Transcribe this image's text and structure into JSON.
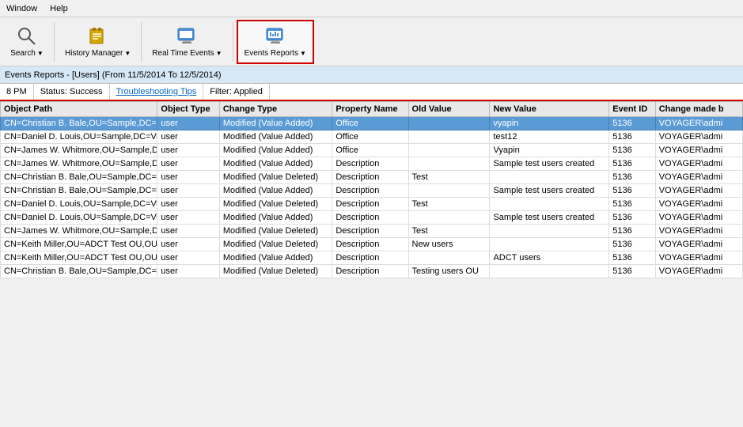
{
  "menu": {
    "items": [
      "Window",
      "Help"
    ]
  },
  "toolbar": {
    "buttons": [
      {
        "id": "search",
        "label": "Search",
        "icon": "🔍",
        "hasDropdown": true,
        "active": false
      },
      {
        "id": "history-manager",
        "label": "History Manager",
        "icon": "📁",
        "hasDropdown": true,
        "active": false
      },
      {
        "id": "real-time-events",
        "label": "Real Time Events",
        "icon": "🖥",
        "hasDropdown": true,
        "active": false
      },
      {
        "id": "events-reports",
        "label": "Events Reports",
        "icon": "📊",
        "hasDropdown": true,
        "active": true
      }
    ]
  },
  "breadcrumb": {
    "text": "Events Reports - [Users] (From 11/5/2014 To 12/5/2014)"
  },
  "status_bar": {
    "time": "8 PM",
    "status": "Status: Success",
    "tips": "Troubleshooting Tips",
    "filter": "Filter: Applied"
  },
  "table": {
    "columns": [
      "Object Path",
      "Object Type",
      "Change Type",
      "Property Name",
      "Old Value",
      "New Value",
      "Event ID",
      "Change made b"
    ],
    "rows": [
      {
        "selected": true,
        "object_path": "CN=Christian B. Bale,OU=Sample,DC=Voyager,DC=local",
        "object_type": "user",
        "change_type": "Modified (Value Added)",
        "property_name": "Office",
        "old_value": "",
        "new_value": "vyapin",
        "event_id": "5136",
        "change_by": "VOYAGER\\admi"
      },
      {
        "selected": false,
        "object_path": "CN=Daniel D. Louis,OU=Sample,DC=Voyager,DC=local",
        "object_type": "user",
        "change_type": "Modified (Value Added)",
        "property_name": "Office",
        "old_value": "",
        "new_value": "test12",
        "event_id": "5136",
        "change_by": "VOYAGER\\admi"
      },
      {
        "selected": false,
        "object_path": "CN=James W. Whitmore,OU=Sample,DC=Voyager,DC=local",
        "object_type": "user",
        "change_type": "Modified (Value Added)",
        "property_name": "Office",
        "old_value": "",
        "new_value": "Vyapin",
        "event_id": "5136",
        "change_by": "VOYAGER\\admi"
      },
      {
        "selected": false,
        "object_path": "CN=James W. Whitmore,OU=Sample,DC=Voyager,DC=local",
        "object_type": "user",
        "change_type": "Modified (Value Added)",
        "property_name": "Description",
        "old_value": "",
        "new_value": "Sample test users created",
        "event_id": "5136",
        "change_by": "VOYAGER\\admi"
      },
      {
        "selected": false,
        "object_path": "CN=Christian B. Bale,OU=Sample,DC=Voyager,DC=local",
        "object_type": "user",
        "change_type": "Modified (Value Deleted)",
        "property_name": "Description",
        "old_value": "Test",
        "new_value": "",
        "event_id": "5136",
        "change_by": "VOYAGER\\admi"
      },
      {
        "selected": false,
        "object_path": "CN=Christian B. Bale,OU=Sample,DC=Voyager,DC=local",
        "object_type": "user",
        "change_type": "Modified (Value Added)",
        "property_name": "Description",
        "old_value": "",
        "new_value": "Sample test users created",
        "event_id": "5136",
        "change_by": "VOYAGER\\admi"
      },
      {
        "selected": false,
        "object_path": "CN=Daniel D. Louis,OU=Sample,DC=Voyager,DC=local",
        "object_type": "user",
        "change_type": "Modified (Value Deleted)",
        "property_name": "Description",
        "old_value": "Test",
        "new_value": "",
        "event_id": "5136",
        "change_by": "VOYAGER\\admi"
      },
      {
        "selected": false,
        "object_path": "CN=Daniel D. Louis,OU=Sample,DC=Voyager,DC=local",
        "object_type": "user",
        "change_type": "Modified (Value Added)",
        "property_name": "Description",
        "old_value": "",
        "new_value": "Sample test users created",
        "event_id": "5136",
        "change_by": "VOYAGER\\admi"
      },
      {
        "selected": false,
        "object_path": "CN=James W. Whitmore,OU=Sample,DC=Voyager,DC=local",
        "object_type": "user",
        "change_type": "Modified (Value Deleted)",
        "property_name": "Description",
        "old_value": "Test",
        "new_value": "",
        "event_id": "5136",
        "change_by": "VOYAGER\\admi"
      },
      {
        "selected": false,
        "object_path": "CN=Keith Miller,OU=ADCT Test OU,OU=ARKAD_Workshop,DC=Voyager,DC=local",
        "object_type": "user",
        "change_type": "Modified (Value Deleted)",
        "property_name": "Description",
        "old_value": "New users",
        "new_value": "",
        "event_id": "5136",
        "change_by": "VOYAGER\\admi"
      },
      {
        "selected": false,
        "object_path": "CN=Keith Miller,OU=ADCT Test OU,OU=ARKAD_Workshop,DC=Voyager,DC=local",
        "object_type": "user",
        "change_type": "Modified (Value Added)",
        "property_name": "Description",
        "old_value": "",
        "new_value": "ADCT users",
        "event_id": "5136",
        "change_by": "VOYAGER\\admi"
      },
      {
        "selected": false,
        "object_path": "CN=Christian B. Bale,OU=Sample,DC=Voyager,DC=local",
        "object_type": "user",
        "change_type": "Modified (Value Deleted)",
        "property_name": "Description",
        "old_value": "Testing users OU",
        "new_value": "",
        "event_id": "5136",
        "change_by": "VOYAGER\\admi"
      }
    ]
  }
}
